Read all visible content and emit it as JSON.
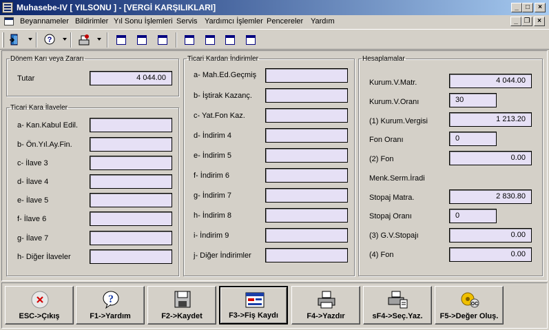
{
  "window": {
    "title": "Muhasebe-IV [ YILSONU ]  - [VERGİ KARŞILIKLARI]",
    "caption_buttons": {
      "minimize": "_",
      "maximize": "□",
      "close": "×"
    },
    "mdi_buttons": {
      "minimize": "_",
      "restore": "❐",
      "close": "×"
    }
  },
  "menu": [
    {
      "label": "Beyannameler"
    },
    {
      "label": "Bildirimler"
    },
    {
      "label": "Yıl Sonu İşlemleri"
    },
    {
      "label": "Servis"
    },
    {
      "label": "Yardımcı İşlemler"
    },
    {
      "label": "Pencereler"
    },
    {
      "label": "Yardım"
    }
  ],
  "toolbar": {
    "icons": [
      "exit-icon",
      "help-icon",
      "tools-icon",
      "window-cascade-icon",
      "window-tile-horizontal-icon",
      "window-tile-vertical-icon",
      "window-restore-icon",
      "window-arrange-icon",
      "window-grid-icon"
    ]
  },
  "donem": {
    "legend": "Dönem Karı veya Zararı",
    "tutar_label": "Tutar",
    "tutar_value": "4 044.00"
  },
  "ilaveler": {
    "legend": "Ticari Kara İlaveler",
    "items": [
      {
        "label": "a- Kan.Kabul Edil.",
        "value": ""
      },
      {
        "label": "b- Ön.Yıl.Ay.Fin.",
        "value": ""
      },
      {
        "label": "c- İlave 3",
        "value": ""
      },
      {
        "label": "d- İlave 4",
        "value": ""
      },
      {
        "label": "e- İlave 5",
        "value": ""
      },
      {
        "label": "f- İlave 6",
        "value": ""
      },
      {
        "label": "g- İlave 7",
        "value": ""
      },
      {
        "label": "h- Diğer İlaveler",
        "value": ""
      }
    ]
  },
  "indirimler": {
    "legend": "Ticari Kardan İndirimler",
    "items": [
      {
        "label": "a- Mah.Ed.Geçmiş",
        "value": ""
      },
      {
        "label": "b- İştirak Kazanç.",
        "value": ""
      },
      {
        "label": "c- Yat.Fon Kaz.",
        "value": ""
      },
      {
        "label": "d- İndirim 4",
        "value": ""
      },
      {
        "label": "e- İndirim 5",
        "value": ""
      },
      {
        "label": "f- İndirim 6",
        "value": ""
      },
      {
        "label": "g- İndirim 7",
        "value": ""
      },
      {
        "label": "h- İndirim 8",
        "value": ""
      },
      {
        "label": "i- İndirim 9",
        "value": ""
      },
      {
        "label": "j- Diğer İndirimler",
        "value": ""
      }
    ]
  },
  "hesaplamalar": {
    "legend": "Hesaplamalar",
    "kurum_matrah_label": "Kurum.V.Matr.",
    "kurum_matrah_value": "4 044.00",
    "kurum_orani_label": "Kurum.V.Oranı",
    "kurum_orani_value": "30",
    "kurum_vergisi_label": "(1) Kurum.Vergisi",
    "kurum_vergisi_value": "1 213.20",
    "fon_orani_label": "Fon Oranı",
    "fon_orani_value": "0",
    "fon2_label": "(2) Fon",
    "fon2_value": "0.00",
    "menk_label": "Menk.Serm.İradi",
    "stopaj_matrah_label": "Stopaj Matra.",
    "stopaj_matrah_value": "2 830.80",
    "stopaj_orani_label": "Stopaj Oranı",
    "stopaj_orani_value": "0",
    "gv_stopaj_label": "(3) G.V.Stopajı",
    "gv_stopaj_value": "0.00",
    "fon4_label": "(4) Fon",
    "fon4_value": "0.00"
  },
  "buttons": [
    {
      "label": "ESC->Çıkış",
      "icon": "cancel-icon"
    },
    {
      "label": "F1->Yardım",
      "icon": "help-icon"
    },
    {
      "label": "F2->Kaydet",
      "icon": "save-disk-icon"
    },
    {
      "label": "F3->Fiş Kaydı",
      "icon": "voucher-icon"
    },
    {
      "label": "F4->Yazdır",
      "icon": "printer-icon"
    },
    {
      "label": "sF4->Seç.Yaz.",
      "icon": "printer-select-icon"
    },
    {
      "label": "F5->Değer Oluş.",
      "icon": "generate-value-icon"
    }
  ],
  "colors": {
    "field_bg": "#e6e0f5",
    "titlebar_start": "#0a246a",
    "titlebar_end": "#a6caf0",
    "face": "#d4d0c8",
    "cancel_red": "#d40000"
  }
}
